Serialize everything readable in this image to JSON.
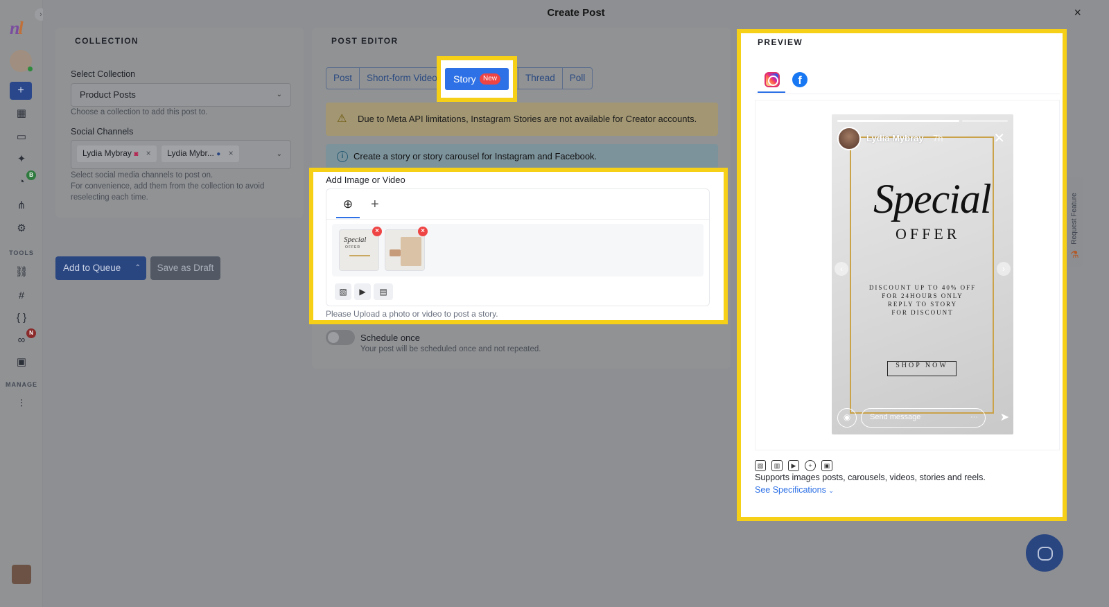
{
  "modal": {
    "title": "Create Post",
    "close": "×"
  },
  "rail": {
    "logo_a": "n",
    "logo_b": "l",
    "expand": "›",
    "add": "+",
    "tools_label": "TOOLS",
    "manage_label": "MANAGE",
    "badge_b": "B",
    "badge_n": "N"
  },
  "collection": {
    "section": "COLLECTION",
    "select_label": "Select Collection",
    "select_value": "Product Posts",
    "select_hint": "Choose a collection to add this post to.",
    "channels_label": "Social Channels",
    "channels": [
      {
        "name": "Lydia Mybray",
        "network": "instagram"
      },
      {
        "name": "Lydia Mybr...",
        "network": "facebook"
      }
    ],
    "channels_hint_1": "Select social media channels to post on.",
    "channels_hint_2": "For convenience, add them from the collection to avoid",
    "channels_hint_3": "reselecting each time."
  },
  "actions": {
    "add_to_queue": "Add to Queue",
    "save_draft": "Save as Draft"
  },
  "editor": {
    "section": "POST EDITOR",
    "tabs": [
      "Post",
      "Short-form Video",
      "Story",
      "Thread",
      "Poll"
    ],
    "story_badge": "New",
    "warning": "Due to Meta API limitations, Instagram Stories are not available for Creator accounts.",
    "info": "Create a story or story carousel for Instagram and Facebook.",
    "media_label": "Add Image or Video",
    "media_hint": "Please Upload a photo or video to post a story.",
    "thumb1_title": "Special",
    "thumb1_sub": "OFFER",
    "schedule_label": "Schedule once",
    "schedule_hint": "Your post will be scheduled once and not repeated."
  },
  "preview": {
    "section": "PREVIEW",
    "profile_name": "Lydia Mybray",
    "time": "7h",
    "headline": "Special",
    "subhead": "OFFER",
    "desc_1": "DISCOUNT UP TO 40% OFF",
    "desc_2": "FOR 24HOURS ONLY",
    "desc_3": "REPLY TO STORY",
    "desc_4": "FOR DISCOUNT",
    "cta": "SHOP NOW",
    "message_placeholder": "Send message",
    "supports": "Supports images posts, carousels, videos, stories and reels.",
    "spec_link": "See Specifications"
  },
  "side": {
    "request_feature": "Request Feature"
  },
  "colors": {
    "highlight": "#f6cf17",
    "primary": "#2e71e6",
    "badge": "#ef4444"
  }
}
